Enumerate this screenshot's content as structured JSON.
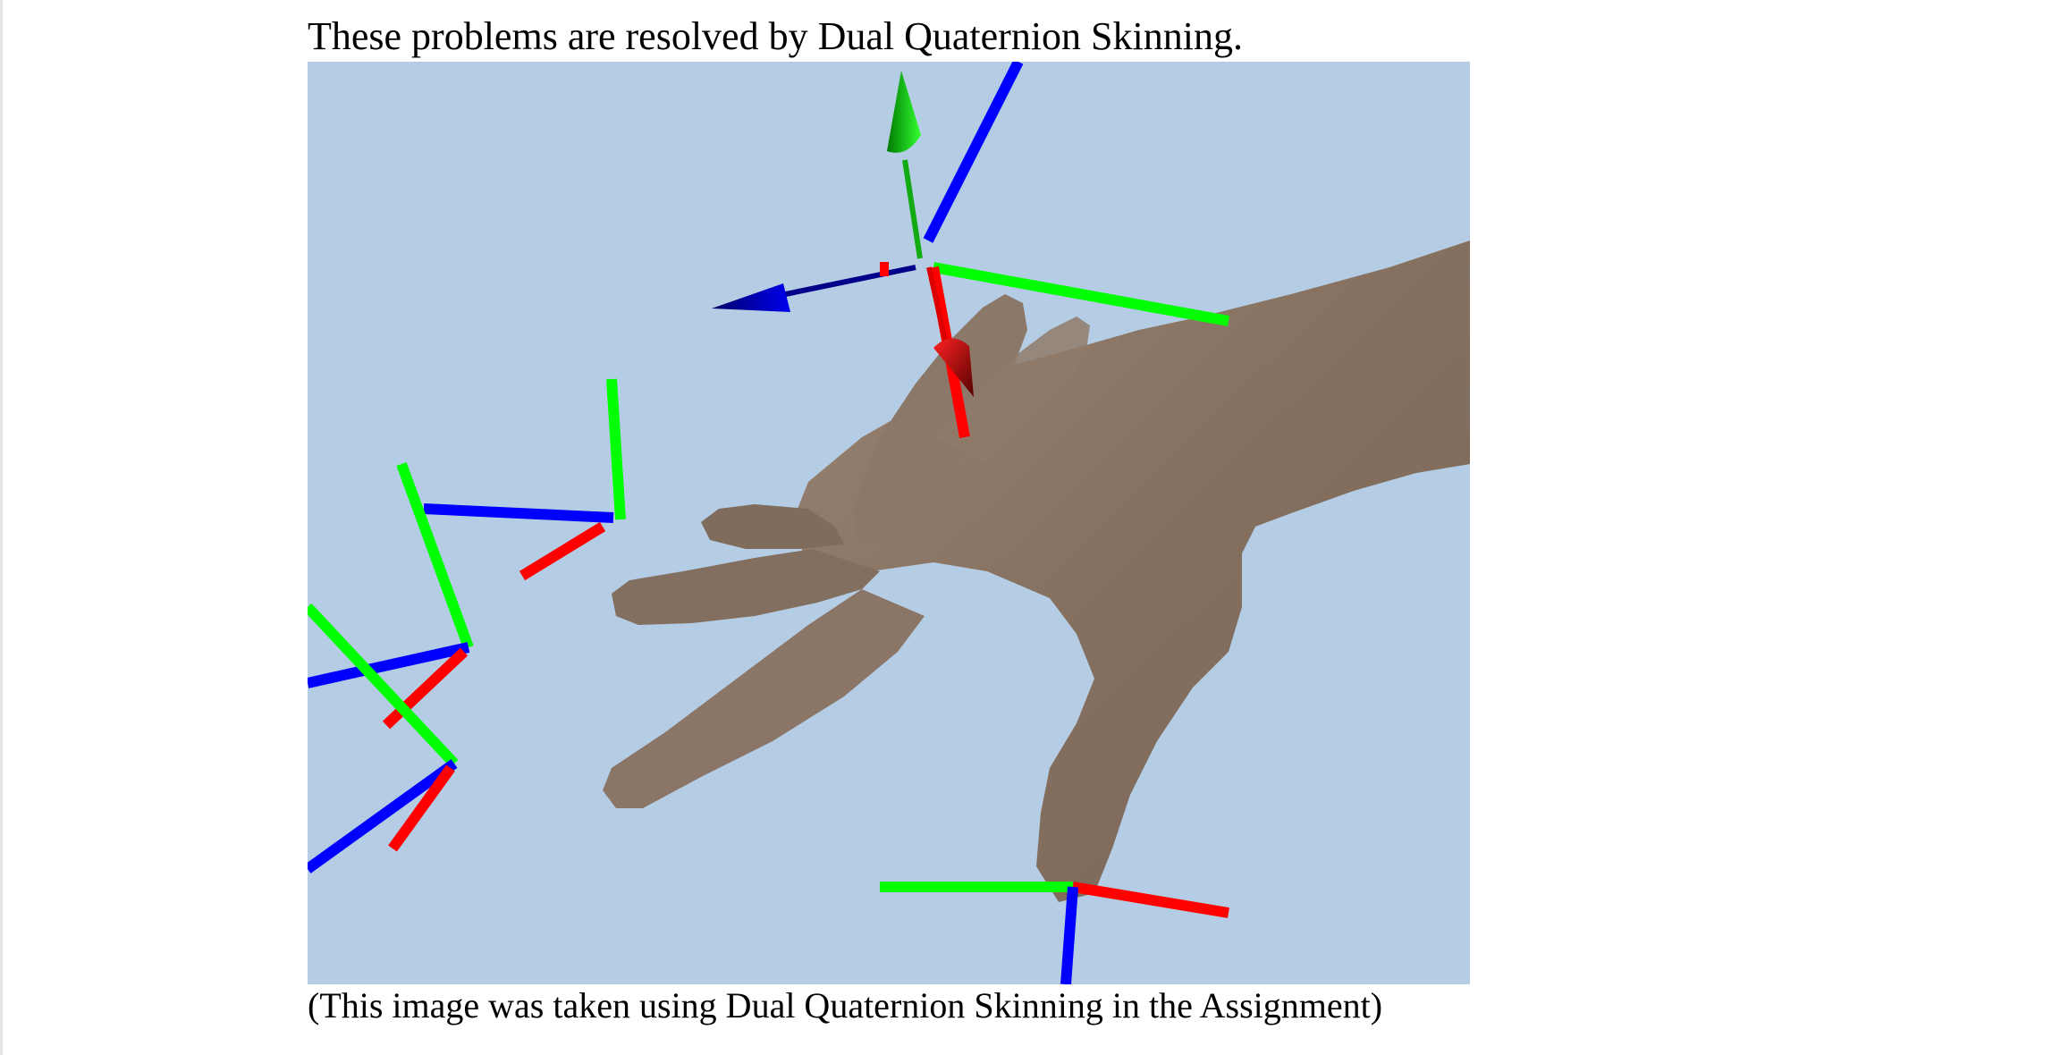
{
  "document": {
    "heading": "These problems are resolved by Dual Quaternion Skinning.",
    "caption": "(This image was taken using Dual Quaternion Skinning in the Assignment)"
  },
  "figure": {
    "description_kind": "3D render of a skinned hand mesh with joint coordinate frames",
    "background_color": "#b4cde4",
    "mesh_color": "#8a7565",
    "axis_colors": {
      "x": "#ff0000",
      "y": "#00ff00",
      "z": "#0000ff"
    },
    "gizmo_icon": "translate-arrows-icon"
  }
}
